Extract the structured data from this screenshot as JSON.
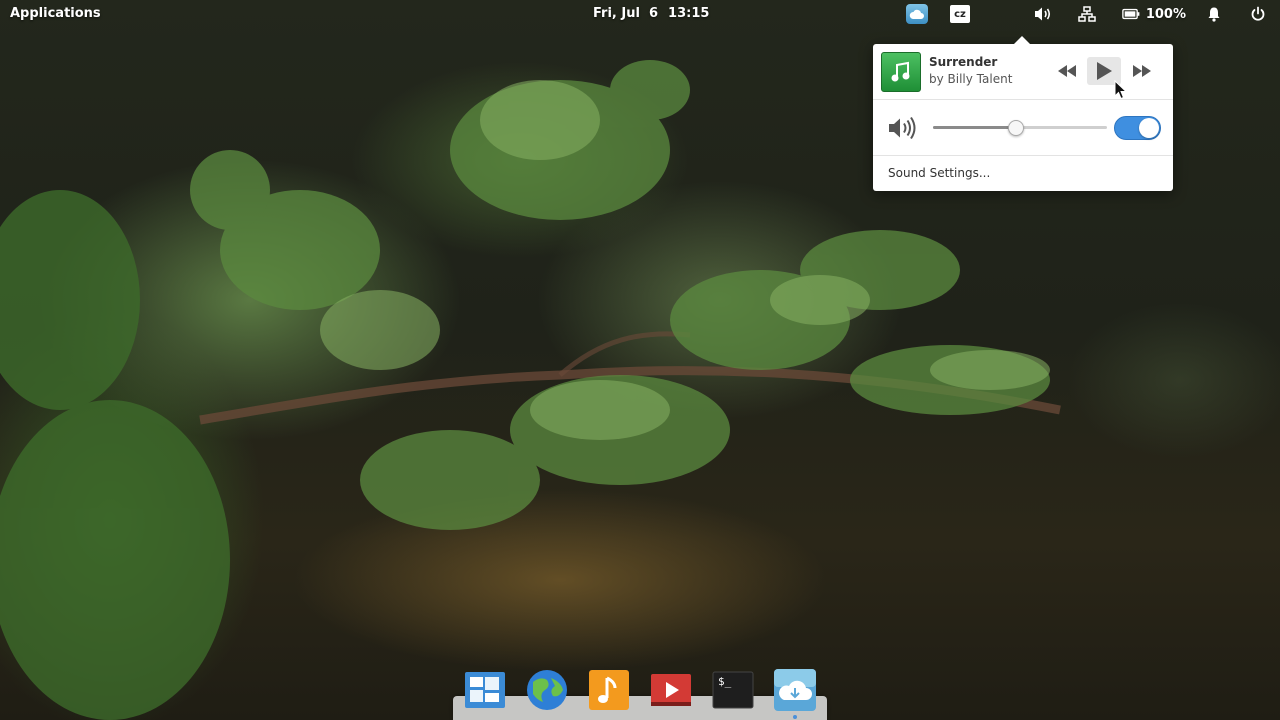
{
  "panel": {
    "applications_label": "Applications",
    "date": "Fri, Jul  6",
    "time": "13:15",
    "keyboard_layout": "cz",
    "battery_percent": "100%"
  },
  "sound_popover": {
    "track_title": "Surrender",
    "track_artist": "by Billy Talent",
    "volume_level": 0.47,
    "sound_enabled": true,
    "settings_label": "Sound Settings..."
  },
  "dock": {
    "items": [
      "multitasking-view",
      "web-browser",
      "music",
      "videos",
      "terminal",
      "cloud-app"
    ],
    "running": [
      "cloud-app"
    ]
  },
  "colors": {
    "accent": "#3f8fe0",
    "album_art": "#2ea84a"
  }
}
